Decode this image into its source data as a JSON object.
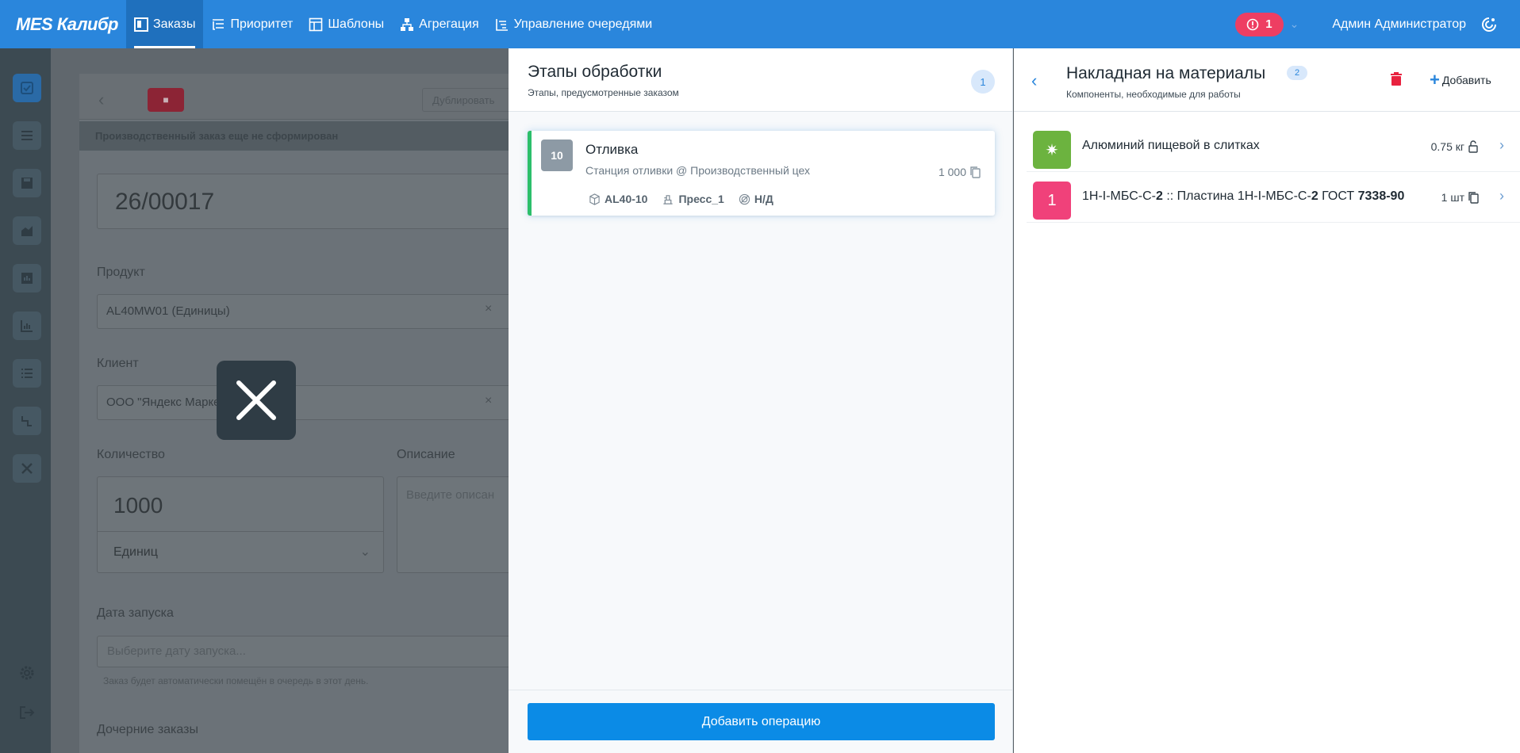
{
  "topbar": {
    "brand": "MES Калибр",
    "nav": [
      {
        "label": "Заказы",
        "icon": "orders-icon",
        "active": true
      },
      {
        "label": "Приоритет",
        "icon": "priority-icon",
        "active": false
      },
      {
        "label": "Шаблоны",
        "icon": "templates-icon",
        "active": false
      },
      {
        "label": "Агрегация",
        "icon": "aggregation-icon",
        "active": false
      },
      {
        "label": "Управление очередями",
        "icon": "queue-icon",
        "active": false
      }
    ],
    "alert_count": "1",
    "user_name": "Админ Администратор",
    "colors": {
      "bar": "#2a86dc",
      "active": "#1f70bd",
      "alert": "#ee3e62"
    }
  },
  "background_form": {
    "duplicate_label": "Дублировать",
    "banner": "Производственный заказ еще не сформирован",
    "order_number": "26/00017",
    "product_label": "Продукт",
    "product_value": "AL40MW01 (Единицы)",
    "client_label": "Клиент",
    "client_value": "ООО \"Яндекс Марке",
    "quantity_label": "Количество",
    "quantity_value": "1000",
    "unit_value": "Единиц",
    "description_label": "Описание",
    "description_placeholder": "Введите описан",
    "launch_date_label": "Дата запуска",
    "launch_date_placeholder": "Выберите дату запуска...",
    "launch_date_hint": "Заказ будет автоматически помещён в очередь в этот день.",
    "child_orders_label": "Дочерние заказы"
  },
  "stages_panel": {
    "title": "Этапы обработки",
    "subtitle": "Этапы, предусмотренные заказом",
    "count": "1",
    "operations": [
      {
        "number": "10",
        "name": "Отливка",
        "station": "Станция отливки @ Производственный цех",
        "quantity": "1 000",
        "tags": {
          "item": "AL40-10",
          "equipment": "Пресс_1",
          "tool": "Н/Д"
        }
      }
    ],
    "add_button": "Добавить операцию",
    "accent_color": "#2cbf6b"
  },
  "materials_panel": {
    "title": "Накладная на материалы",
    "count": "2",
    "subtitle": "Компоненты, необходимые для работы",
    "add_label": "Добавить",
    "items": [
      {
        "icon_text": "✷",
        "icon_color": "#6cb33f",
        "name_plain": "Алюминий пищевой в слитках",
        "quantity": "0.75 кг",
        "qty_icon": "lock-icon"
      },
      {
        "icon_text": "1",
        "icon_color": "#f0417a",
        "name_part1": "1Н-I-МБС-С-",
        "name_bold1": "2",
        "name_part2": " :: Пластина 1Н-I-МБС-С-",
        "name_bold2": "2",
        "name_part3": " ГОСТ ",
        "name_bold3": "7338-90",
        "quantity": "1 шт",
        "qty_icon": "copy-icon"
      }
    ]
  }
}
